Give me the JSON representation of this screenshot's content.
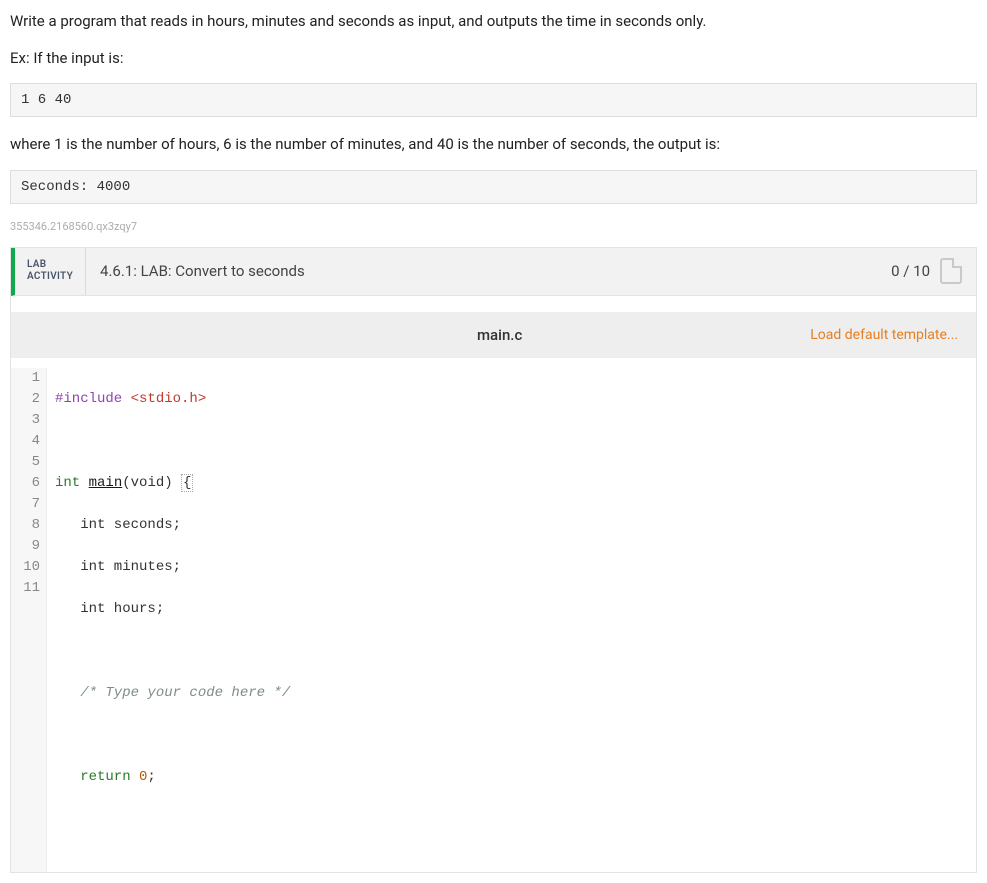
{
  "problem": {
    "intro": "Write a program that reads in hours, minutes and seconds as input, and outputs the time in seconds only.",
    "ex_label": "Ex: If the input is:",
    "input_sample": "1 6 40",
    "explain": "where 1 is the number of hours, 6 is the number of minutes, and 40 is the number of seconds, the output is:",
    "output_sample": "Seconds: 4000",
    "idtag": "355346.2168560.qx3zqy7"
  },
  "activity": {
    "badge_line1": "LAB",
    "badge_line2": "ACTIVITY",
    "title": "4.6.1: LAB: Convert to seconds",
    "score": "0 / 10"
  },
  "editor": {
    "filename": "main.c",
    "load_template": "Load default template...",
    "lines": [
      "1",
      "2",
      "3",
      "4",
      "5",
      "6",
      "7",
      "8",
      "9",
      "10",
      "11"
    ],
    "code": {
      "l1_pp": "#include",
      "l1_hdr": "<stdio.h>",
      "l3_type": "int",
      "l3_fn": "main",
      "l3_sig": "(void) ",
      "l3_brace": "{",
      "l4": "   int seconds;",
      "l5": "   int minutes;",
      "l6": "   int hours;",
      "l8": "   /* Type your code here */",
      "l10_ret": "   return ",
      "l10_num": "0",
      "l10_semi": ";"
    }
  }
}
